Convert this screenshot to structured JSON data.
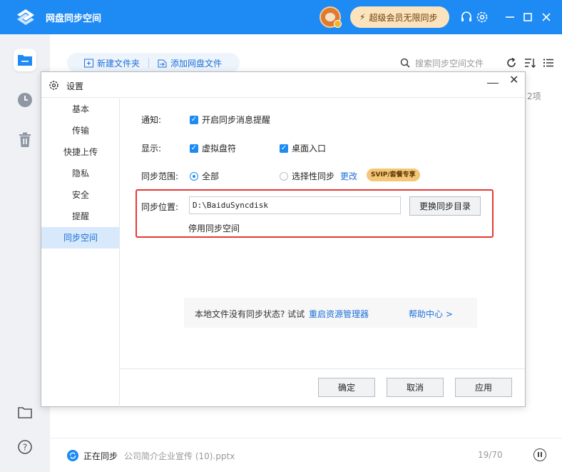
{
  "app": {
    "title": "网盘同步空间",
    "vip_button": "超级会员无限同步",
    "brand_color": "#1e8bf5"
  },
  "toolbar": {
    "new_folder": "新建文件夹",
    "add_cloud_file": "添加网盘文件",
    "search_placeholder": "搜索同步空间文件",
    "count_text": "2项"
  },
  "status": {
    "label": "正在同步",
    "file": "公司简介企业宣传 (10).pptx",
    "progress": "19/70"
  },
  "dialog": {
    "title": "设置",
    "nav": [
      "基本",
      "传输",
      "快捷上传",
      "隐私",
      "安全",
      "提醒",
      "同步空间"
    ],
    "active_nav": "同步空间",
    "notify_label": "通知:",
    "notify_option": "开启同步消息提醒",
    "display_label": "显示:",
    "display_virtual": "虚拟盘符",
    "display_desktop": "桌面入口",
    "scope_label": "同步范围:",
    "scope_all": "全部",
    "scope_selective": "选择性同步",
    "scope_change": "更改",
    "svip_tag": "SVIP/套餐专享",
    "location_label": "同步位置:",
    "location_value": "D:\\BaiduSyncdisk",
    "change_dir_button": "更换同步目录",
    "disable_link": "停用同步空间",
    "hint_text": "本地文件没有同步状态? 试试",
    "hint_link": "重启资源管理器",
    "help_link": "帮助中心 >",
    "ok_button": "确定",
    "cancel_button": "取消",
    "apply_button": "应用"
  }
}
